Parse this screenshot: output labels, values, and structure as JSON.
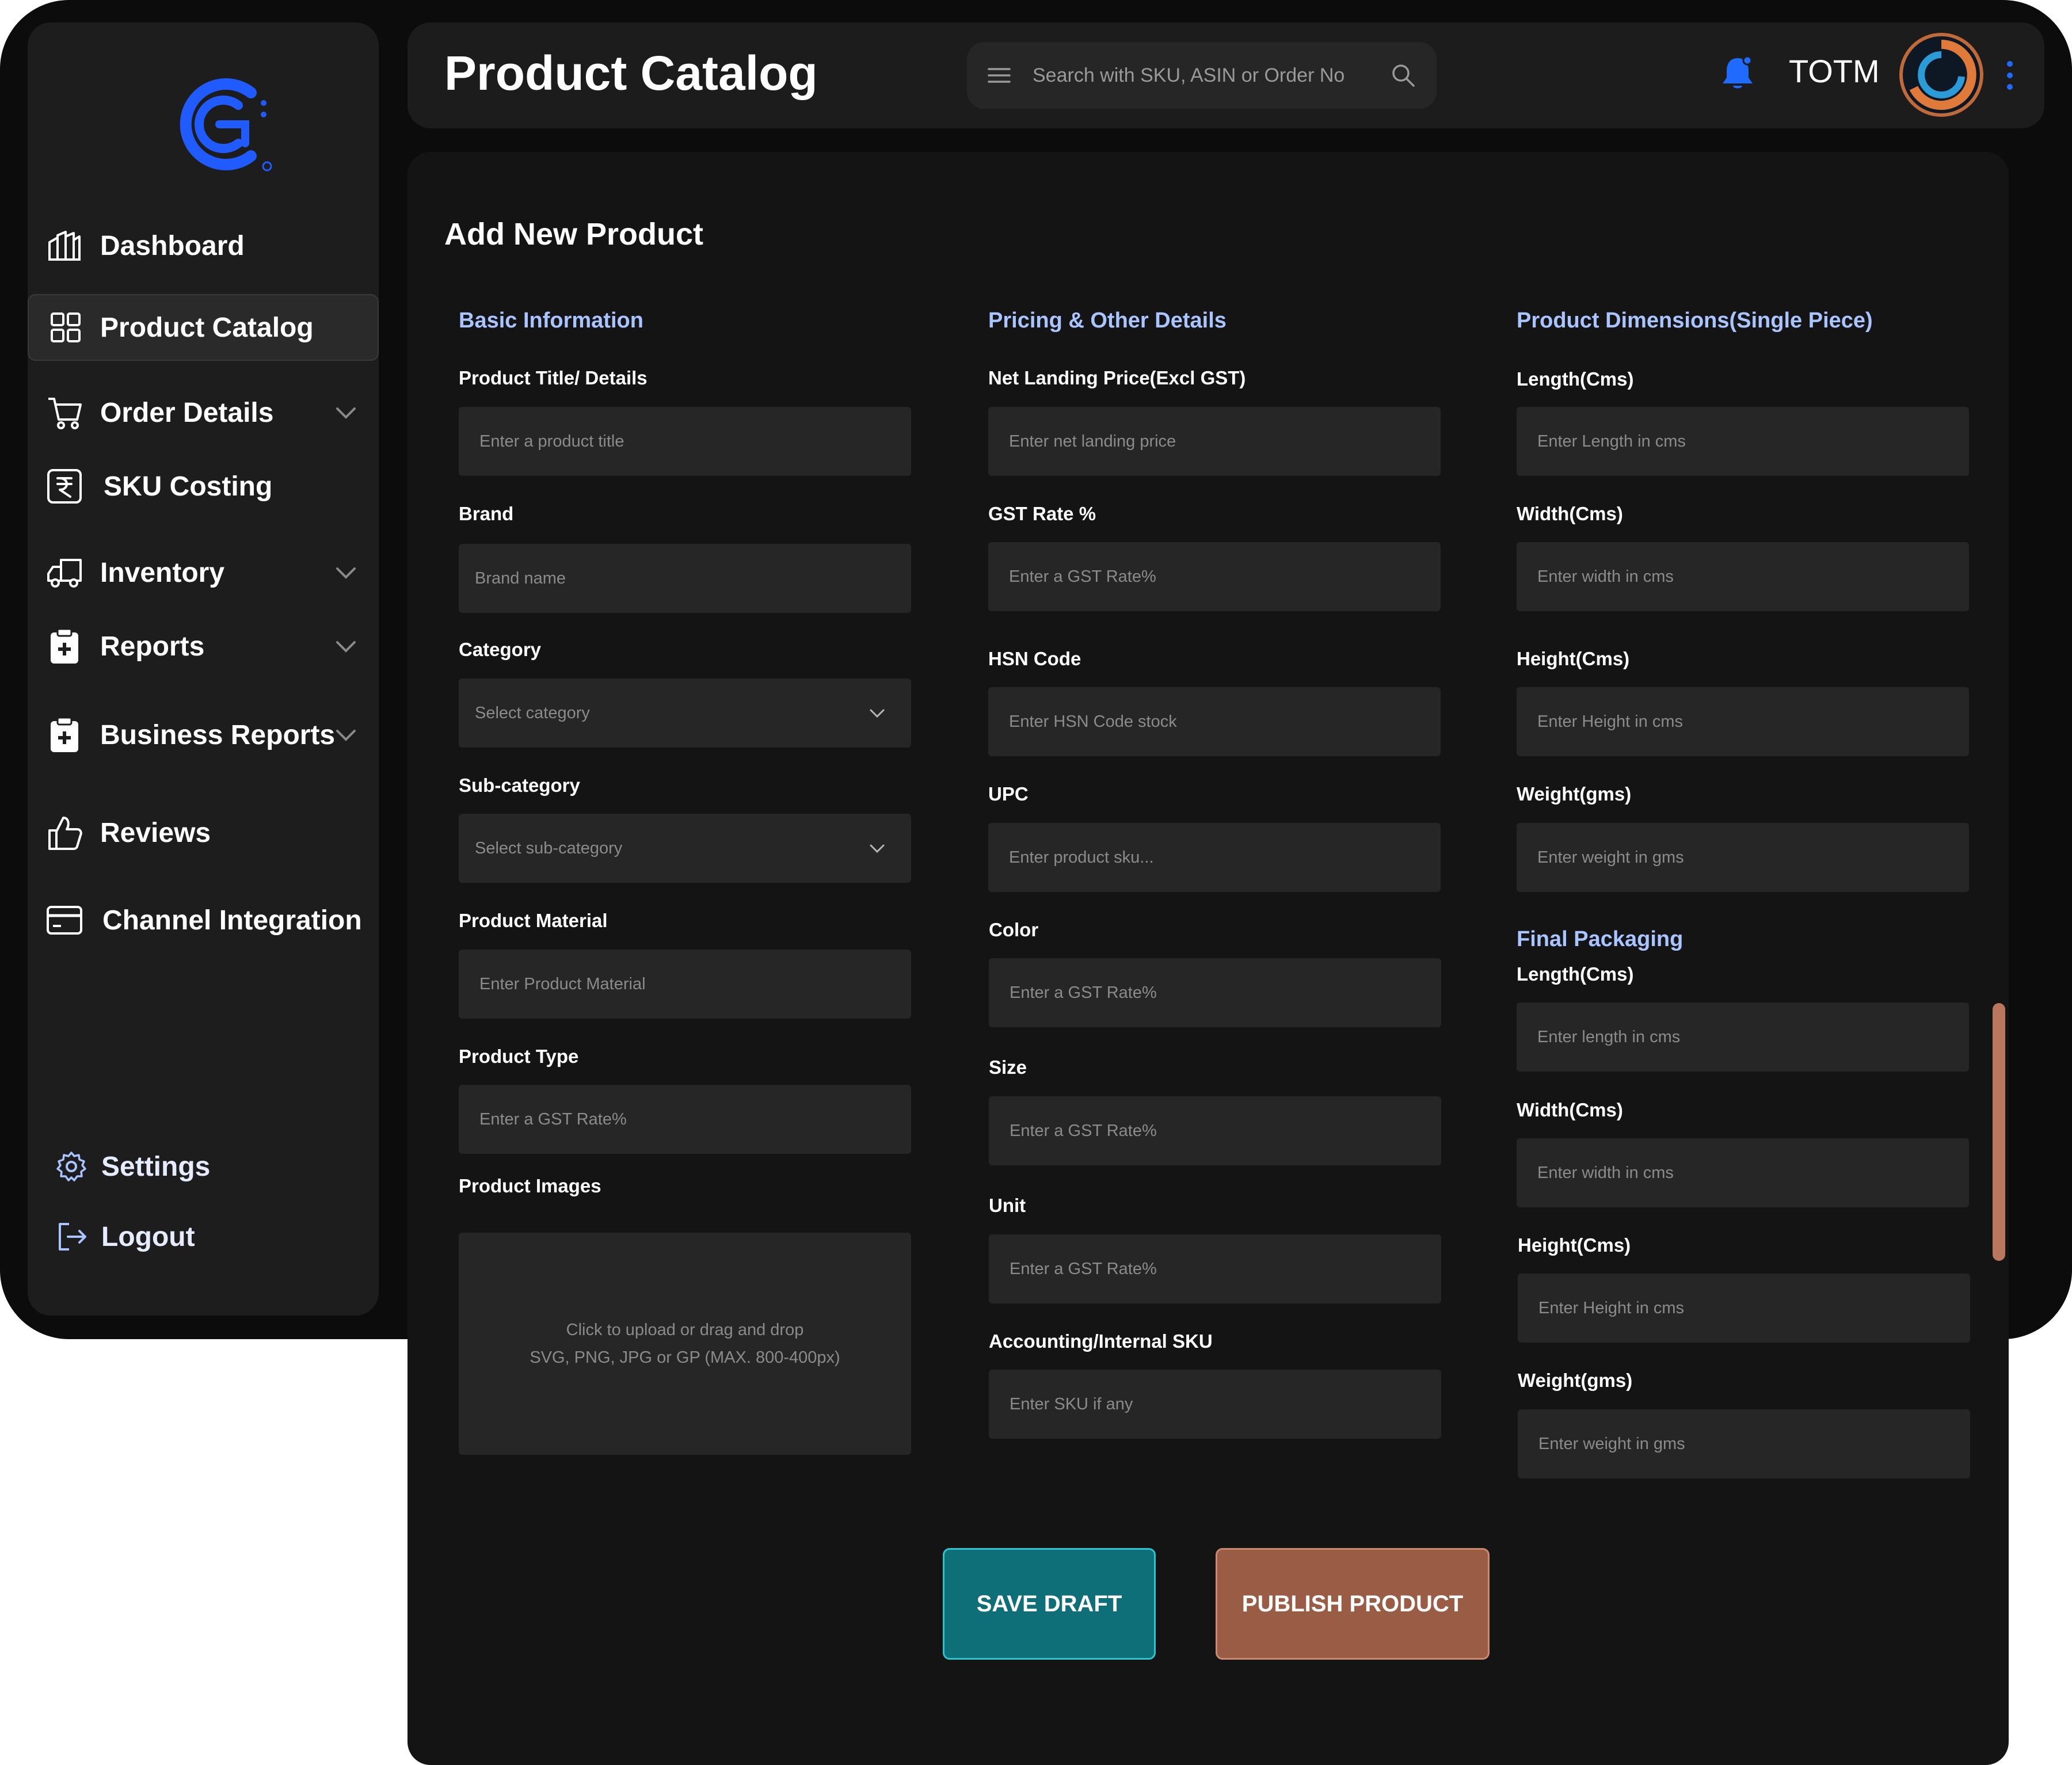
{
  "header": {
    "title": "Product Catalog",
    "search_placeholder": "Search with SKU, ASIN or Order No",
    "user_name": "TOTM"
  },
  "sidebar": {
    "items": [
      {
        "label": "Dashboard",
        "icon": "dashboard-icon"
      },
      {
        "label": "Product Catalog",
        "icon": "grid-icon",
        "active": true
      },
      {
        "label": "Order Details",
        "icon": "cart-icon",
        "expandable": true
      },
      {
        "label": "SKU Costing",
        "icon": "rupee-icon"
      },
      {
        "label": "Inventory",
        "icon": "truck-icon",
        "expandable": true
      },
      {
        "label": "Reports",
        "icon": "clipboard-plus-icon",
        "expandable": true
      },
      {
        "label": "Business Reports",
        "icon": "clipboard-plus-icon",
        "expandable": true
      },
      {
        "label": "Reviews",
        "icon": "thumbs-up-icon"
      },
      {
        "label": "Channel Integration",
        "icon": "card-icon"
      }
    ],
    "footer": [
      {
        "label": "Settings",
        "icon": "gear-icon"
      },
      {
        "label": "Logout",
        "icon": "logout-icon"
      }
    ]
  },
  "form": {
    "heading": "Add New Product",
    "basic": {
      "title": "Basic Information",
      "fields": [
        {
          "label": "Product Title/ Details",
          "placeholder": "Enter a product title"
        },
        {
          "label": "Brand",
          "placeholder": "Brand name"
        },
        {
          "label": "Category",
          "placeholder": "Select category"
        },
        {
          "label": "Sub-category",
          "placeholder": "Select sub-category"
        },
        {
          "label": "Product Material",
          "placeholder": "Enter Product Material"
        },
        {
          "label": "Product Type",
          "placeholder": "Enter a GST Rate%"
        }
      ],
      "images_label": "Product Images",
      "upload_line1": "Click to upload or drag and drop",
      "upload_line2": "SVG, PNG, JPG or GP (MAX. 800-400px)"
    },
    "pricing": {
      "title": "Pricing & Other Details",
      "fields": [
        {
          "label": "Net Landing Price(Excl GST)",
          "placeholder": "Enter net landing price"
        },
        {
          "label": "GST Rate %",
          "placeholder": "Enter a GST Rate%"
        },
        {
          "label": "HSN Code",
          "placeholder": "Enter HSN Code stock"
        },
        {
          "label": "UPC",
          "placeholder": "Enter product sku..."
        },
        {
          "label": "Color",
          "placeholder": "Enter a GST Rate%"
        },
        {
          "label": "Size",
          "placeholder": "Enter a GST Rate%"
        },
        {
          "label": "Unit",
          "placeholder": "Enter a GST Rate%"
        },
        {
          "label": "Accounting/Internal SKU",
          "placeholder": "Enter SKU if any"
        }
      ]
    },
    "dimensions": {
      "title": "Product Dimensions(Single Piece)",
      "fields": [
        {
          "label": "Length(Cms)",
          "placeholder": "Enter Length in cms"
        },
        {
          "label": "Width(Cms)",
          "placeholder": "Enter width in cms"
        },
        {
          "label": "Height(Cms)",
          "placeholder": "Enter Height in cms"
        },
        {
          "label": "Weight(gms)",
          "placeholder": "Enter weight in gms"
        }
      ]
    },
    "packaging": {
      "title": "Final Packaging",
      "fields": [
        {
          "label": "Length(Cms)",
          "placeholder": "Enter length in cms"
        },
        {
          "label": "Width(Cms)",
          "placeholder": "Enter width in cms"
        },
        {
          "label": "Height(Cms)",
          "placeholder": "Enter Height in cms"
        },
        {
          "label": "Weight(gms)",
          "placeholder": "Enter weight in gms"
        }
      ]
    },
    "save_label": "SAVE DRAFT",
    "publish_label": "PUBLISH PRODUCT"
  },
  "colors": {
    "accent_blue": "#1a5cff",
    "section_title": "#aac4ff",
    "save_button": "#0f6f78",
    "publish_button": "#9a5c44"
  }
}
